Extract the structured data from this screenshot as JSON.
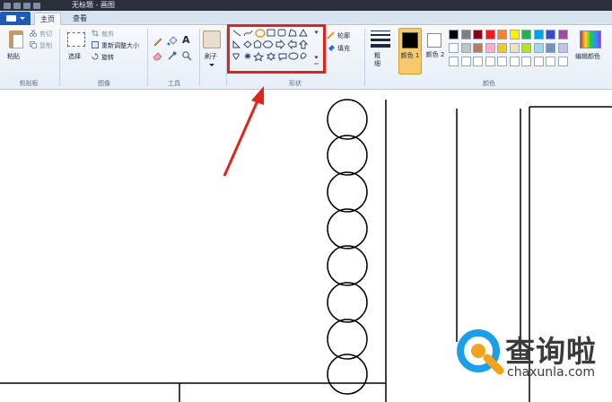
{
  "window": {
    "title": "无标题 - 画图"
  },
  "tabs": [
    {
      "label": "主页"
    },
    {
      "label": "查看"
    }
  ],
  "clipboard": {
    "paste_label": "粘贴",
    "cut_label": "剪切",
    "copy_label": "复制",
    "group_label": "剪贴板"
  },
  "image": {
    "select_label": "选择",
    "crop_label": "裁剪",
    "resize_label": "重新调整大小",
    "rotate_label": "旋转",
    "group_label": "图像"
  },
  "tools": {
    "group_label": "工具"
  },
  "brushes": {
    "label": "刷子"
  },
  "shapes": {
    "outline_label": "轮廓",
    "fill_label": "填充",
    "group_label": "形状"
  },
  "colors": {
    "size_label": "粗细",
    "color1_label": "颜色 1",
    "color2_label": "颜色 2",
    "edit_label": "编辑颜色",
    "group_label": "颜色",
    "palette_row1": [
      "#000000",
      "#7f7f7f",
      "#880015",
      "#ed1c24",
      "#ff7f27",
      "#fff200",
      "#22b14c",
      "#00a2e8",
      "#3f48cc",
      "#a349a4"
    ],
    "palette_row2": [
      "#ffffff",
      "#c3c3c3",
      "#b97a57",
      "#ffaec9",
      "#ffc90e",
      "#efe4b0",
      "#b5e61d",
      "#99d9ea",
      "#7092be",
      "#c8bfe7"
    ],
    "color1_value": "#000000",
    "color2_value": "#ffffff",
    "highlight_color": "#e2231a"
  },
  "watermark": {
    "text_cn": "查询啦",
    "url": "chaxunla.com"
  }
}
